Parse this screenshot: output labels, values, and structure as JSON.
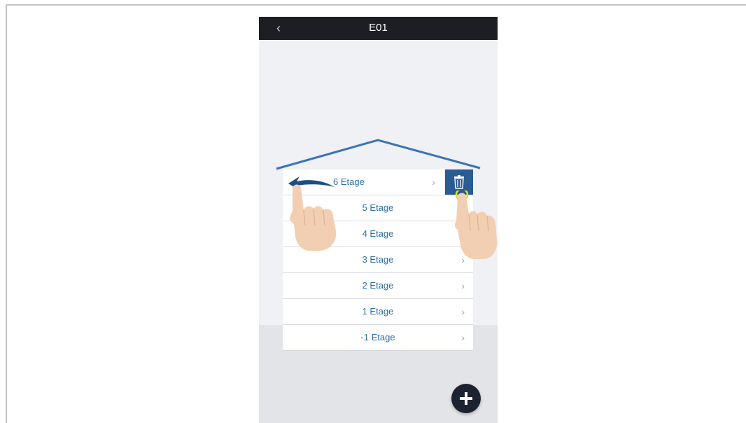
{
  "nav": {
    "back_icon": "‹",
    "title": "E01"
  },
  "floors": [
    {
      "label": "6 Etage",
      "swiped": true
    },
    {
      "label": "5 Etage"
    },
    {
      "label": "4 Etage"
    },
    {
      "label": "3 Etage"
    },
    {
      "label": "2 Etage"
    },
    {
      "label": "1 Etage"
    },
    {
      "label": "-1 Etage"
    }
  ],
  "chevron": "›",
  "icons": {
    "back": "back-chevron-icon",
    "row_chevron": "chevron-right-icon",
    "delete": "trash-icon",
    "add": "plus-icon"
  },
  "colors": {
    "nav_bar": "#1c1e24",
    "label_blue": "#2f6fa8",
    "roof_blue": "#3a73b7",
    "delete_bg": "#2a5b93",
    "fab_bg": "#1c2330",
    "hand_skin": "#f2cfb2",
    "tap_highlight": "#d9e21f"
  }
}
